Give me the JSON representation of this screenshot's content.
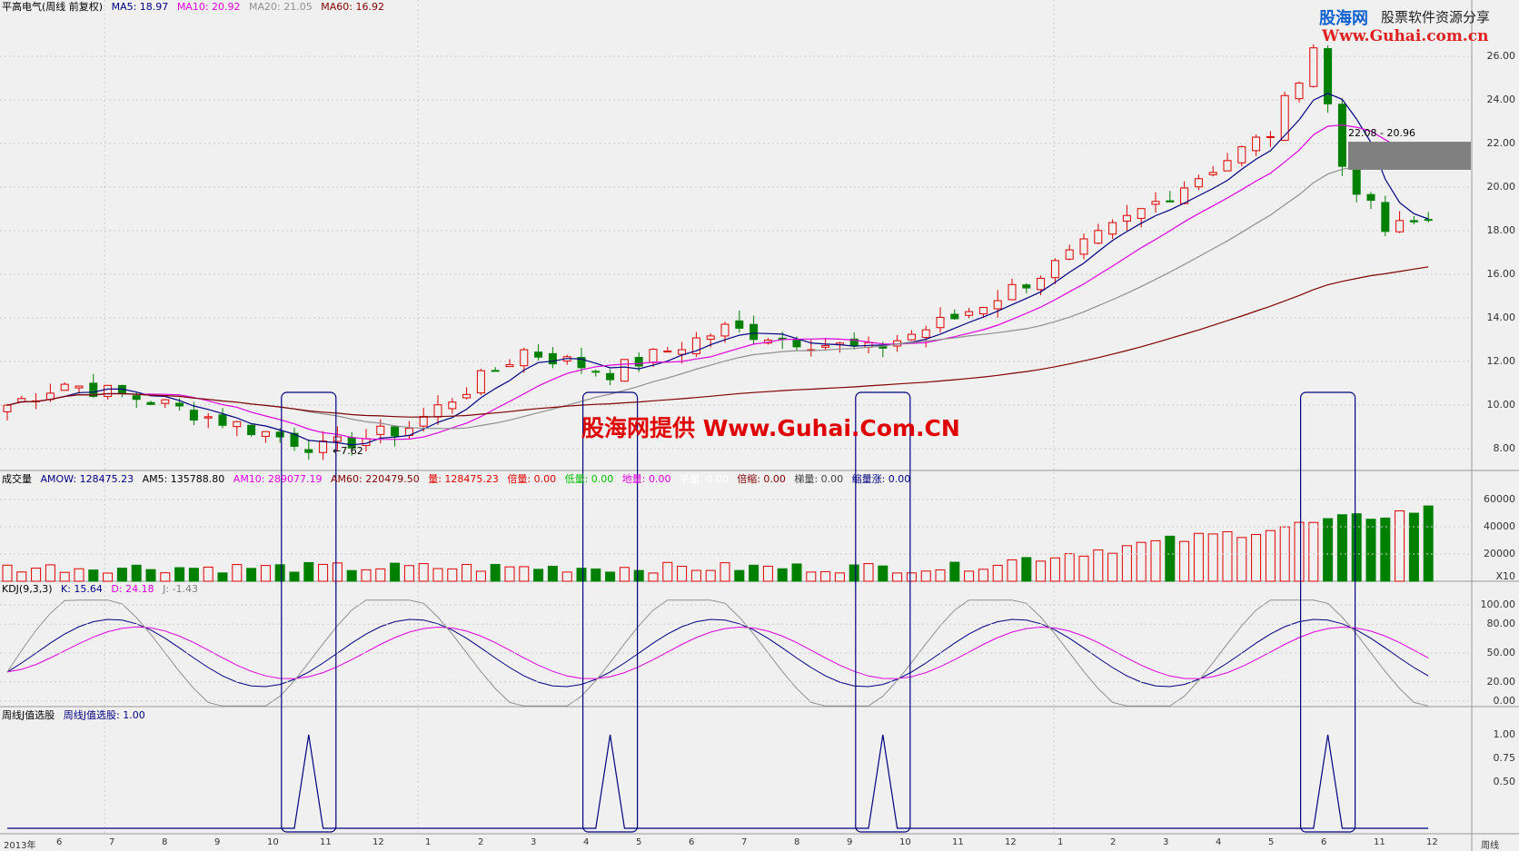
{
  "header_main": {
    "name": "平高电气(周线 前复权)",
    "ma5": "MA5: 18.97",
    "ma10": "MA10: 20.92",
    "ma20": "MA20: 21.05",
    "ma60": "MA60: 16.92"
  },
  "header_vol": {
    "title": "成交量",
    "amow": "AMOW: 128475.23",
    "am5": "AM5: 135788.80",
    "am10": "AM10: 289077.19",
    "am60": "AM60: 220479.50",
    "liang": "量: 128475.23",
    "beiliang": "倍量: 0.00",
    "diliang": "低量: 0.00",
    "diliang2": "地量: 0.00",
    "pingliang": "平量: 0.00",
    "beisuo": "倍缩: 0.00",
    "tiliang": "梯量: 0.00",
    "suoliangzhang": "缩量涨: 0.00"
  },
  "header_kdj": {
    "title": "KDJ(9,3,3)",
    "k": "K: 15.64",
    "d": "D: 24.18",
    "j": "J: -1.43"
  },
  "header_j": {
    "title": "周线J值选股",
    "value": "周线J值选股: 1.00"
  },
  "price_axis": [
    "26.00",
    "24.00",
    "22.00",
    "20.00",
    "18.00",
    "16.00",
    "14.00",
    "12.00",
    "10.00",
    "8.00"
  ],
  "vol_axis": [
    "60000",
    "40000",
    "20000",
    "X10"
  ],
  "kdj_axis": [
    "100.00",
    "80.00",
    "50.00",
    "20.00",
    "0.00"
  ],
  "j_axis": [
    "1.00",
    "0.75",
    "0.50"
  ],
  "x_axis": [
    "2013年",
    "6",
    "7",
    "8",
    "9",
    "10",
    "11",
    "12",
    "1",
    "2",
    "3",
    "4",
    "5",
    "6",
    "7",
    "8",
    "9",
    "10",
    "11",
    "12",
    "1",
    "2",
    "3",
    "4",
    "5",
    "6",
    "11",
    "12"
  ],
  "period_label": "周线",
  "annotations": {
    "low_marker": "←7.62",
    "range_label": "22.08 - 20.96"
  },
  "watermark": "股海网提供 Www.Guhai.Com.CN",
  "logo": {
    "name": "股海网",
    "slogan": "股票软件资源分享",
    "url": "Www.Guhai.com.cn"
  },
  "colors": {
    "up": "#e00000",
    "down": "#008000",
    "ma5": "#000080",
    "ma10": "#e000e0",
    "ma20": "#909090",
    "ma60": "#800000",
    "box": "#000080"
  },
  "chart_data": [
    {
      "type": "candlestick",
      "title": "平高电气(周线 前复权)",
      "ylim": [
        7,
        27
      ],
      "ohlc": [],
      "low_marked": 7.62
    },
    {
      "type": "bar",
      "title": "成交量",
      "ylim": [
        0,
        70000
      ]
    },
    {
      "type": "line",
      "title": "KDJ(9,3,3)",
      "ylim": [
        0,
        100
      ],
      "series": [
        {
          "name": "K",
          "last": 15.64
        },
        {
          "name": "D",
          "last": 24.18
        },
        {
          "name": "J",
          "last": -1.43
        }
      ]
    },
    {
      "type": "line",
      "title": "周线J值选股",
      "ylim": [
        0,
        1
      ],
      "signals_at_bar": [
        21,
        42,
        61,
        92
      ]
    }
  ]
}
